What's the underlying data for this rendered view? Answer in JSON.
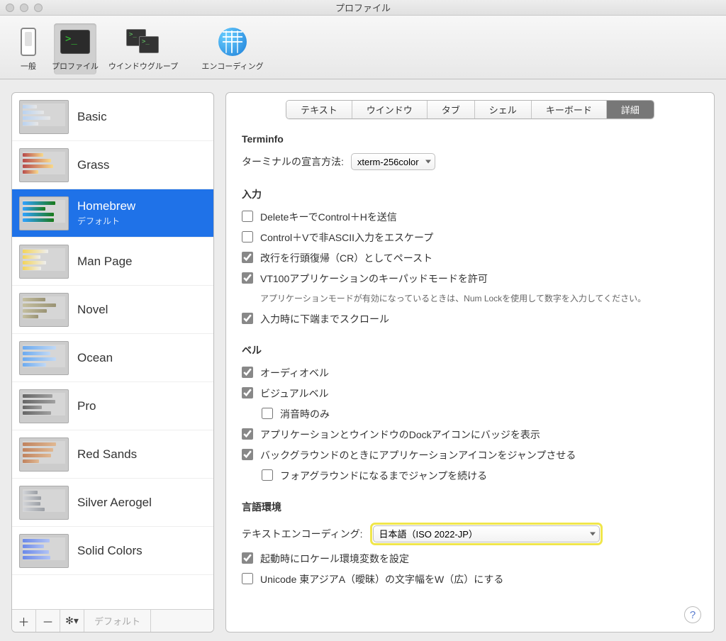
{
  "window": {
    "title": "プロファイル"
  },
  "toolbar": {
    "general": "一般",
    "profiles": "プロファイル",
    "window_groups": "ウインドウグループ",
    "encoding": "エンコーディング"
  },
  "sidebar": {
    "profiles": [
      {
        "name": "Basic",
        "thumb": "tb-basic"
      },
      {
        "name": "Grass",
        "thumb": "tb-grass"
      },
      {
        "name": "Homebrew",
        "sub": "デフォルト",
        "selected": true,
        "thumb": "tb-homebrew"
      },
      {
        "name": "Man Page",
        "thumb": "tb-manpage"
      },
      {
        "name": "Novel",
        "thumb": "tb-novel"
      },
      {
        "name": "Ocean",
        "thumb": "tb-ocean"
      },
      {
        "name": "Pro",
        "thumb": "tb-pro"
      },
      {
        "name": "Red Sands",
        "thumb": "tb-redsands"
      },
      {
        "name": "Silver Aerogel",
        "thumb": "tb-silver"
      },
      {
        "name": "Solid Colors",
        "thumb": "tb-solid"
      }
    ],
    "footer": {
      "default_label": "デフォルト"
    }
  },
  "tabs": {
    "items": [
      "テキスト",
      "ウインドウ",
      "タブ",
      "シェル",
      "キーボード",
      "詳細"
    ],
    "active": 5
  },
  "panel": {
    "terminfo": {
      "heading": "Terminfo",
      "declare_label": "ターミナルの宣言方法:",
      "declare_value": "xterm-256color"
    },
    "input": {
      "heading": "入力",
      "delete_ctrl_h": "DeleteキーでControl＋Hを送信",
      "ctrl_v_escape": "Control＋Vで非ASCII入力をエスケープ",
      "paste_as_cr": "改行を行頭復帰（CR）としてペースト",
      "vt100_keypad": "VT100アプリケーションのキーパッドモードを許可",
      "vt100_note": "アプリケーションモードが有効になっているときは、Num Lockを使用して数字を入力してください。",
      "scroll_bottom": "入力時に下端までスクロール"
    },
    "bell": {
      "heading": "ベル",
      "audio": "オーディオベル",
      "visual": "ビジュアルベル",
      "mute_only": "消音時のみ",
      "dock_badge": "アプリケーションとウインドウのDockアイコンにバッジを表示",
      "bounce_bg": "バックグラウンドのときにアプリケーションアイコンをジャンプさせる",
      "bounce_until_fg": "フォアグラウンドになるまでジャンプを続ける"
    },
    "locale": {
      "heading": "言語環境",
      "encoding_label": "テキストエンコーディング:",
      "encoding_value": "日本語（ISO 2022-JP）",
      "set_env": "起動時にロケール環境変数を設定",
      "east_asian_wide": "Unicode 東アジアA（曖昧）の文字幅をW（広）にする"
    }
  }
}
